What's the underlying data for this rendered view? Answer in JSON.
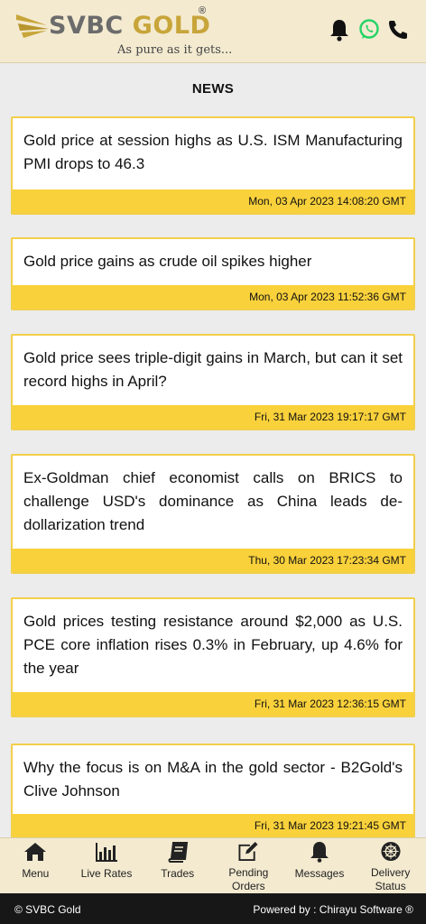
{
  "header": {
    "brand_left": "SVBC",
    "brand_right": "GOLD",
    "registered": "®",
    "tagline": "As pure as it gets...",
    "icons": [
      "bell-icon",
      "whatsapp-icon",
      "phone-icon"
    ],
    "colors": {
      "header_bg": "#f3ead0",
      "gold": "#c8a53a",
      "whatsapp": "#25d366"
    }
  },
  "page": {
    "title": "NEWS"
  },
  "news": [
    {
      "headline": "Gold price at session highs as U.S. ISM Manufacturing PMI drops to 46.3",
      "date": "Mon, 03 Apr 2023 14:08:20 GMT"
    },
    {
      "headline": "Gold price gains as crude oil spikes higher",
      "date": "Mon, 03 Apr 2023 11:52:36 GMT"
    },
    {
      "headline": "Gold price sees triple-digit gains in March, but can it set record highs in April?",
      "date": "Fri, 31 Mar 2023 19:17:17 GMT"
    },
    {
      "headline": "Ex-Goldman chief economist calls on BRICS to challenge USD's dominance as China leads de-dollarization trend",
      "date": "Thu, 30 Mar 2023 17:23:34 GMT"
    },
    {
      "headline": "Gold prices testing resistance around $2,000 as U.S. PCE core inflation rises 0.3% in February, up 4.6% for the year",
      "date": "Fri, 31 Mar 2023 12:36:15 GMT"
    },
    {
      "headline": "Why the focus is on M&A in the gold sector - B2Gold's Clive Johnson",
      "date": "Fri, 31 Mar 2023 19:21:45 GMT"
    }
  ],
  "tabs": [
    {
      "label": "Menu",
      "icon": "home-icon"
    },
    {
      "label": "Live Rates",
      "icon": "bar-chart-icon"
    },
    {
      "label": "Trades",
      "icon": "book-icon"
    },
    {
      "label": "Pending Orders",
      "icon": "edit-icon"
    },
    {
      "label": "Messages",
      "icon": "bell-icon"
    },
    {
      "label": "Delivery Status",
      "icon": "delivery-icon"
    }
  ],
  "footer": {
    "copyright": "© SVBC Gold",
    "powered_by": "Powered by : Chirayu Software ®"
  },
  "colors": {
    "card_border": "#f2cf4a",
    "date_bar": "#f9d13b",
    "footer_bg": "#171717"
  }
}
